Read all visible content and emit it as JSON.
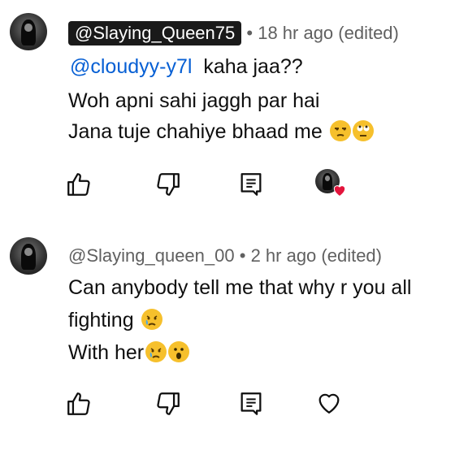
{
  "comments": [
    {
      "author": "@Slaying_Queen75",
      "time": "18 hr ago (edited)",
      "mention": "@cloudyy-y7l",
      "line1_rest": "kaha jaa??",
      "line2": "Woh apni sahi jaggh par hai",
      "line3": "Jana tuje chahiye bhaad me",
      "line3_emojis": [
        "unamused-face-emoji",
        "face-with-rolling-eyes-emoji"
      ],
      "actions": [
        "like",
        "dislike",
        "reply",
        "creator-heart"
      ]
    },
    {
      "author": "@Slaying_queen_00",
      "time": "2 hr ago (edited)",
      "line1": "Can anybody tell me that why r you all",
      "line2": "fighting",
      "line2_emojis": [
        "crying-face-emoji"
      ],
      "line3": "With her",
      "line3_emojis": [
        "crying-face-emoji",
        "face-with-open-mouth-emoji"
      ],
      "actions": [
        "like",
        "dislike",
        "reply",
        "heart"
      ]
    }
  ],
  "separator": "•",
  "colors": {
    "mention": "#065fd4",
    "meta": "#606060",
    "heart": "#e3143c"
  }
}
